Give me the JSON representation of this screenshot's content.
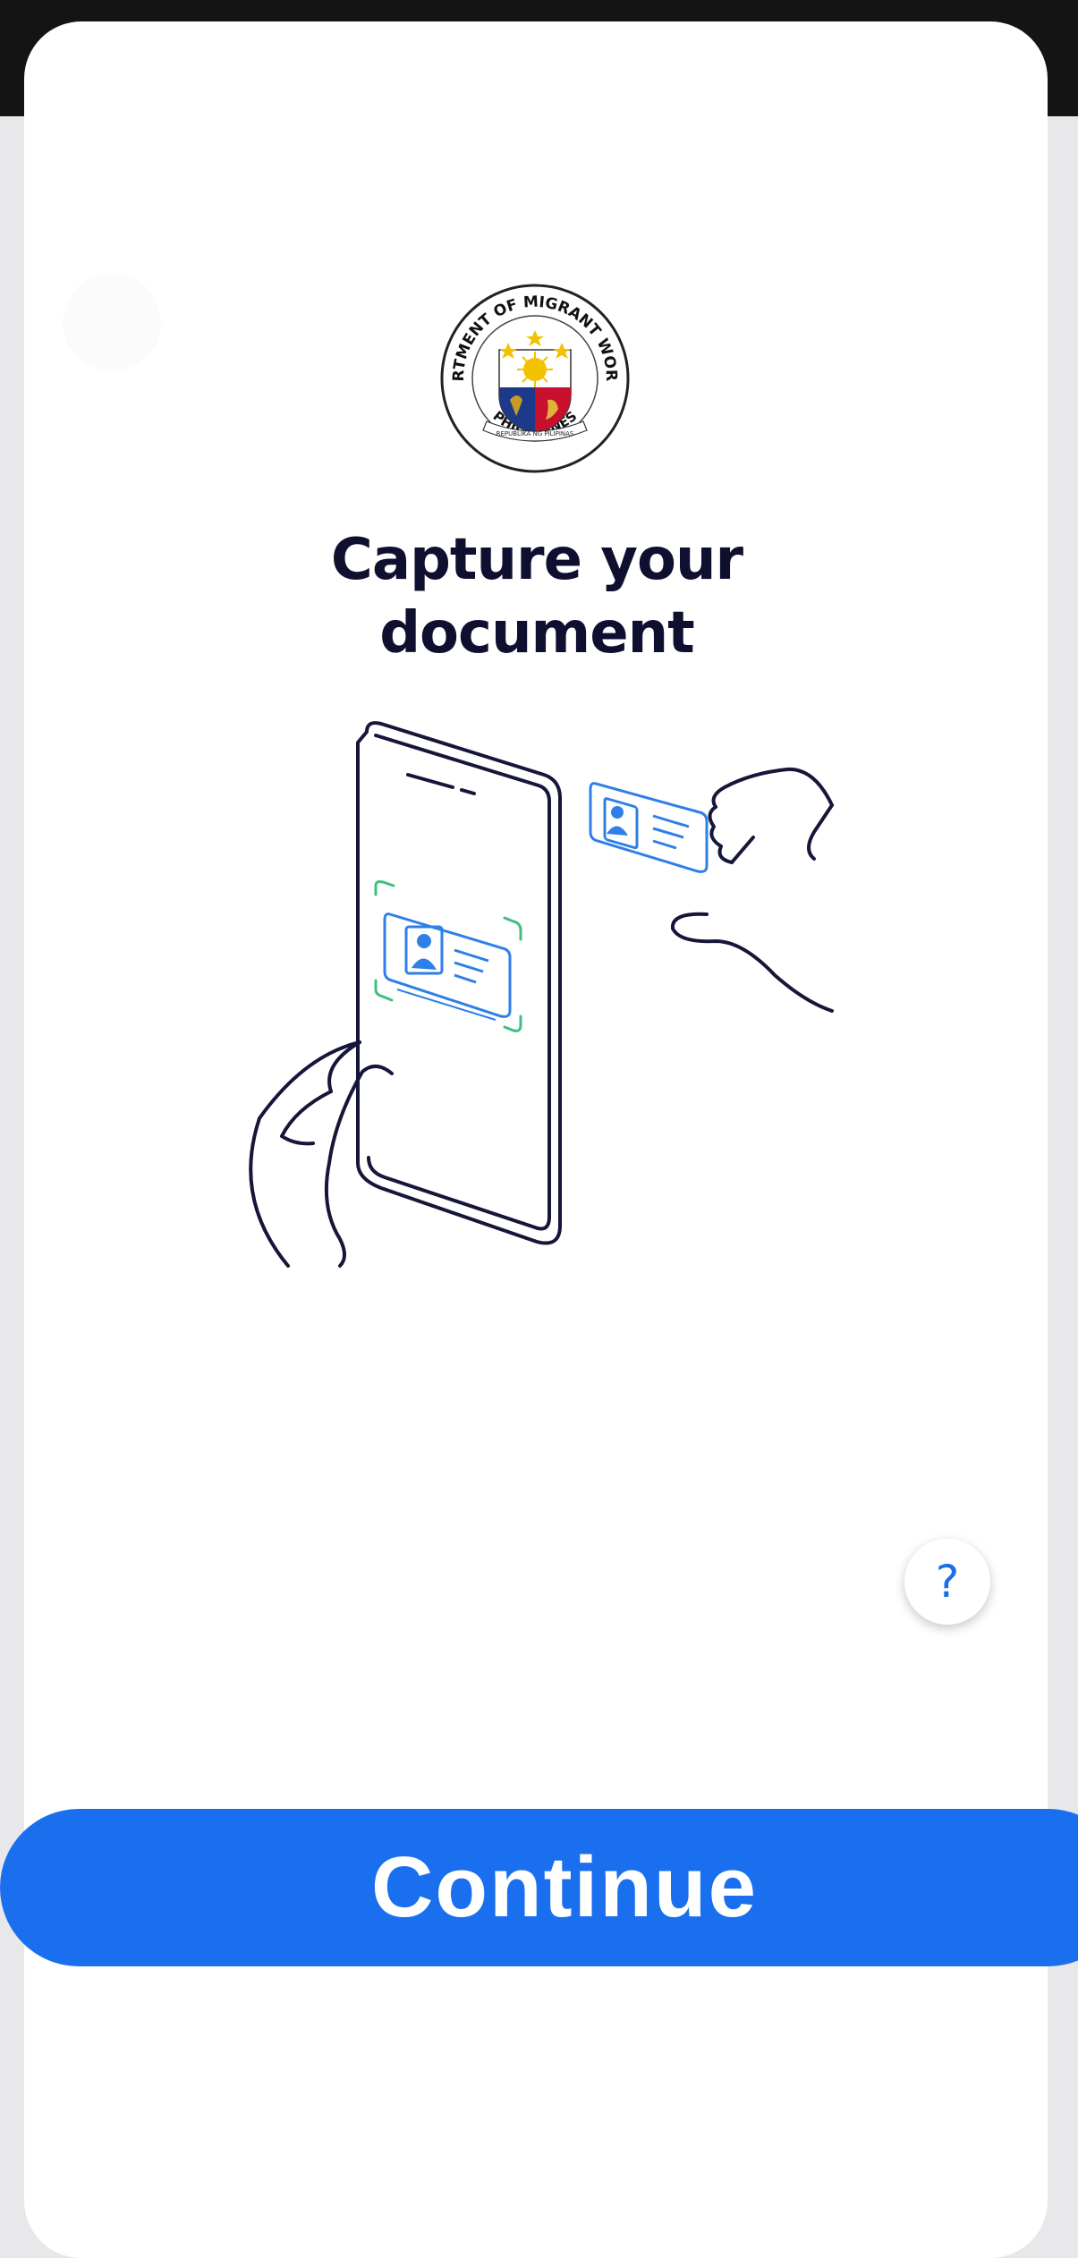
{
  "header": {
    "title": "Capture your\ndocument"
  },
  "seal": {
    "arc_top": "DEPARTMENT OF MIGRANT WORKERS",
    "arc_bottom": "PHILIPPINES",
    "ribbon": "REPUBLIKA NG PILIPINAS"
  },
  "help": {
    "label": "?"
  },
  "actions": {
    "continue_label": "Continue"
  },
  "colors": {
    "accent": "#1a6fef",
    "title": "#0f1030",
    "frame_green": "#3fbf7f",
    "card_blue": "#2f7fe8"
  }
}
